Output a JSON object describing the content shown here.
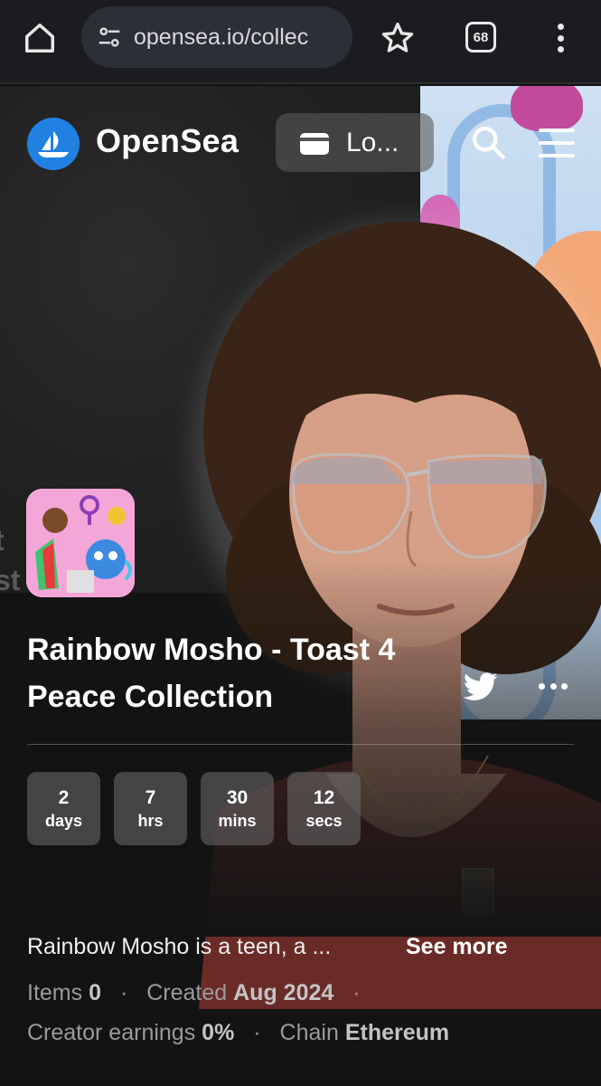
{
  "browser": {
    "url": "opensea.io/collec",
    "tab_count": "68"
  },
  "header": {
    "brand": "OpenSea",
    "login_label": "Lo..."
  },
  "banner": {
    "edge_text_line1": "t",
    "edge_text_line2": "st"
  },
  "collection": {
    "title": "Rainbow Mosho - Toast 4 Peace Collection",
    "description": "Rainbow Mosho is a teen, a ...",
    "see_more": "See more",
    "countdown": [
      {
        "value": "2",
        "unit": "days"
      },
      {
        "value": "7",
        "unit": "hrs"
      },
      {
        "value": "30",
        "unit": "mins"
      },
      {
        "value": "12",
        "unit": "secs"
      }
    ],
    "stats": {
      "items_label": "Items",
      "items_value": "0",
      "created_label": "Created",
      "created_value": "Aug 2024",
      "earnings_label": "Creator earnings",
      "earnings_value": "0%",
      "chain_label": "Chain",
      "chain_value": "Ethereum"
    }
  },
  "colors": {
    "brand_blue": "#2081e2",
    "background": "#131313"
  },
  "icons": [
    "home-icon",
    "site-settings-icon",
    "star-icon",
    "tabs-icon",
    "kebab-menu-icon",
    "opensea-logo-icon",
    "wallet-icon",
    "search-icon",
    "hamburger-menu-icon",
    "twitter-icon",
    "more-options-icon"
  ]
}
